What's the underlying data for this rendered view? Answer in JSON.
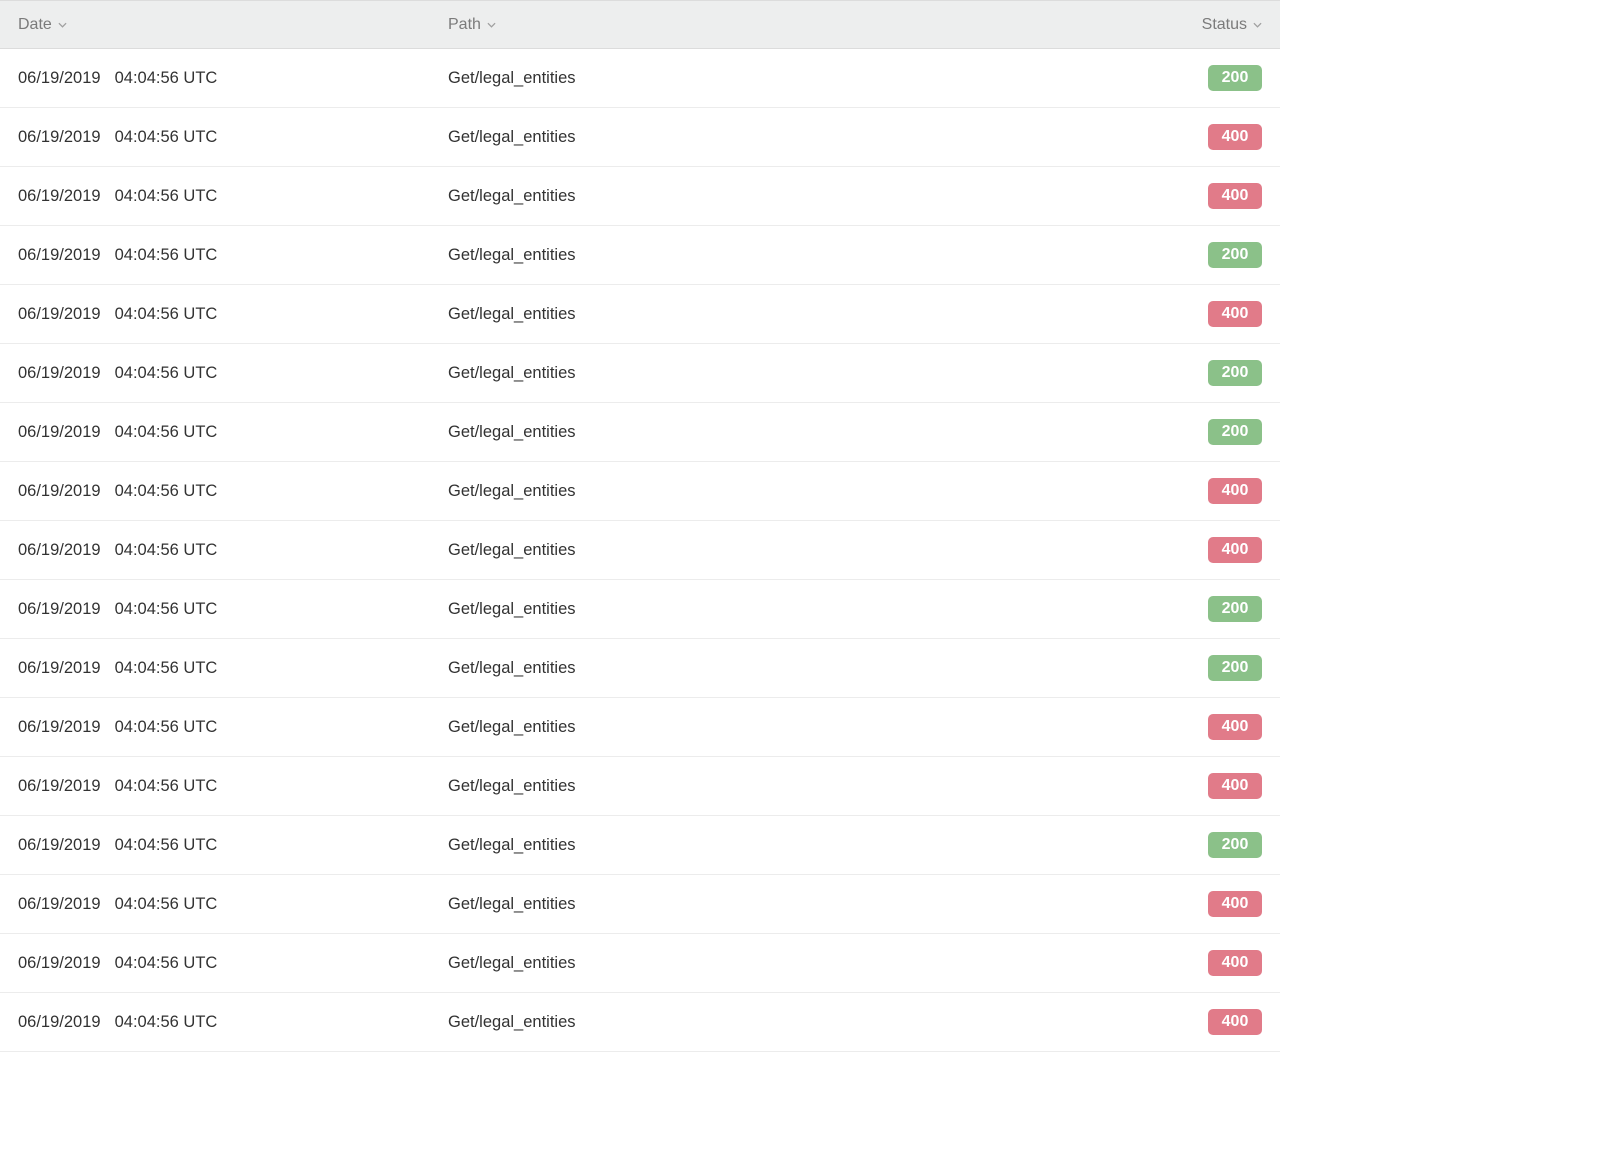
{
  "columns": {
    "date": "Date",
    "path": "Path",
    "status": "Status"
  },
  "rows": [
    {
      "date": "06/19/2019",
      "time": "04:04:56 UTC",
      "path": "Get/legal_entities",
      "status": "200"
    },
    {
      "date": "06/19/2019",
      "time": "04:04:56 UTC",
      "path": "Get/legal_entities",
      "status": "400"
    },
    {
      "date": "06/19/2019",
      "time": "04:04:56 UTC",
      "path": "Get/legal_entities",
      "status": "400"
    },
    {
      "date": "06/19/2019",
      "time": "04:04:56 UTC",
      "path": "Get/legal_entities",
      "status": "200"
    },
    {
      "date": "06/19/2019",
      "time": "04:04:56 UTC",
      "path": "Get/legal_entities",
      "status": "400"
    },
    {
      "date": "06/19/2019",
      "time": "04:04:56 UTC",
      "path": "Get/legal_entities",
      "status": "200"
    },
    {
      "date": "06/19/2019",
      "time": "04:04:56 UTC",
      "path": "Get/legal_entities",
      "status": "200"
    },
    {
      "date": "06/19/2019",
      "time": "04:04:56 UTC",
      "path": "Get/legal_entities",
      "status": "400"
    },
    {
      "date": "06/19/2019",
      "time": "04:04:56 UTC",
      "path": "Get/legal_entities",
      "status": "400"
    },
    {
      "date": "06/19/2019",
      "time": "04:04:56 UTC",
      "path": "Get/legal_entities",
      "status": "200"
    },
    {
      "date": "06/19/2019",
      "time": "04:04:56 UTC",
      "path": "Get/legal_entities",
      "status": "200"
    },
    {
      "date": "06/19/2019",
      "time": "04:04:56 UTC",
      "path": "Get/legal_entities",
      "status": "400"
    },
    {
      "date": "06/19/2019",
      "time": "04:04:56 UTC",
      "path": "Get/legal_entities",
      "status": "400"
    },
    {
      "date": "06/19/2019",
      "time": "04:04:56 UTC",
      "path": "Get/legal_entities",
      "status": "200"
    },
    {
      "date": "06/19/2019",
      "time": "04:04:56 UTC",
      "path": "Get/legal_entities",
      "status": "400"
    },
    {
      "date": "06/19/2019",
      "time": "04:04:56 UTC",
      "path": "Get/legal_entities",
      "status": "400"
    },
    {
      "date": "06/19/2019",
      "time": "04:04:56 UTC",
      "path": "Get/legal_entities",
      "status": "400"
    }
  ]
}
